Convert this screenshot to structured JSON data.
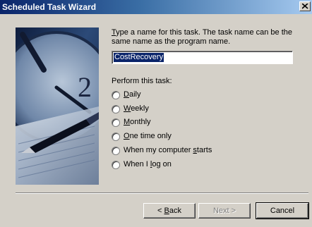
{
  "window": {
    "title": "Scheduled Task Wizard"
  },
  "prompt": {
    "mnemonic": "T",
    "rest": "ype a name for this task.  The task name can be the same name as the program name."
  },
  "task_name": {
    "value": "CostRecovery"
  },
  "perform": {
    "label": "Perform this task:",
    "options": [
      {
        "mnemonic": "D",
        "rest": "aily"
      },
      {
        "mnemonic": "W",
        "rest": "eekly"
      },
      {
        "mnemonic": "M",
        "rest": "onthly"
      },
      {
        "mnemonic": "O",
        "rest": "ne time only"
      },
      {
        "pre": "When my computer ",
        "mnemonic": "s",
        "rest": "tarts"
      },
      {
        "pre": "When I ",
        "mnemonic": "l",
        "rest": "og on"
      }
    ]
  },
  "buttons": {
    "back_mnemonic": "B",
    "back_rest": "ack",
    "next": "Next >",
    "cancel": "Cancel"
  }
}
